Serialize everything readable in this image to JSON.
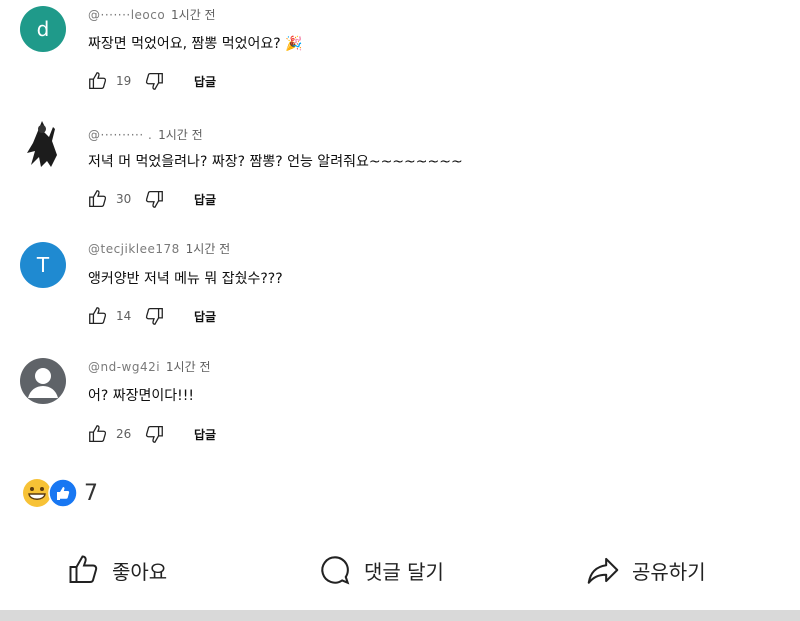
{
  "comments": [
    {
      "avatar_letter": "d",
      "avatar_color": "#1f9a8a",
      "handle": "@·······leoco",
      "time": "1시간 전",
      "text": "짜장면 먹었어요, 짬뽕 먹었어요? 🎉",
      "likes": "19",
      "reply": "답글"
    },
    {
      "avatar_letter": "",
      "avatar_color": "#ffffff",
      "handle": "@·········· .",
      "time": "1시간 전",
      "text": "저녁 머 먹었을려나? 짜장? 짬뽕? 언능 알려줘요~~~~~~~~",
      "likes": "30",
      "reply": "답글"
    },
    {
      "avatar_letter": "T",
      "avatar_color": "#1f8ad1",
      "handle": "@tecjiklee178",
      "time": "1시간 전",
      "text": "앵커양반 저녁 메뉴 뭐 잡쉈수???",
      "likes": "14",
      "reply": "답글"
    },
    {
      "avatar_letter": "",
      "avatar_color": "#5f6368",
      "handle": "@nd-wg42i",
      "time": "1시간 전",
      "text": "어? 짜장면이다!!!",
      "likes": "26",
      "reply": "답글"
    }
  ],
  "reactions": {
    "count": "7",
    "icons": [
      "grin-emoji",
      "like-emoji"
    ]
  },
  "bottom_bar": {
    "like_label": "좋아요",
    "comment_label": "댓글 달기",
    "share_label": "공유하기"
  }
}
